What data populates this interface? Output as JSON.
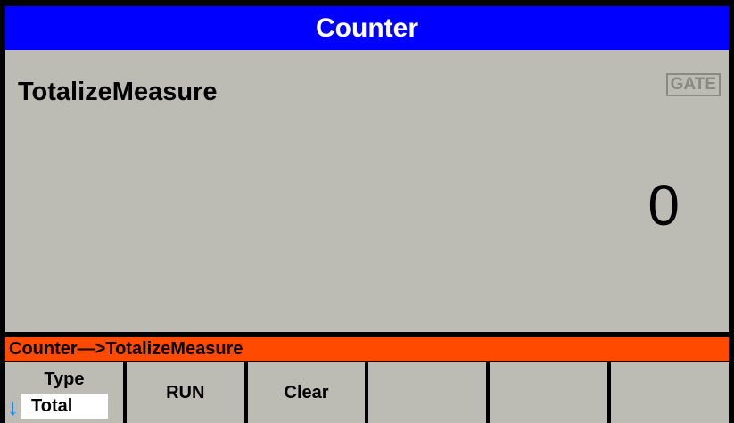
{
  "title": "Counter",
  "main": {
    "mode_label": "TotalizeMeasure",
    "gate_label": "GATE",
    "value": "0"
  },
  "path_bar": "Counter—>TotalizeMeasure",
  "softkeys": [
    {
      "label": "Type",
      "value": "Total",
      "icon": "down-arrow-icon"
    },
    {
      "label": "RUN"
    },
    {
      "label": "Clear"
    },
    {
      "label": ""
    },
    {
      "label": ""
    },
    {
      "label": ""
    }
  ],
  "colors": {
    "title_bar": "#0000ff",
    "path_bar": "#ff4a00",
    "panel": "#bcbcb4",
    "arrow": "#1a8cff"
  }
}
